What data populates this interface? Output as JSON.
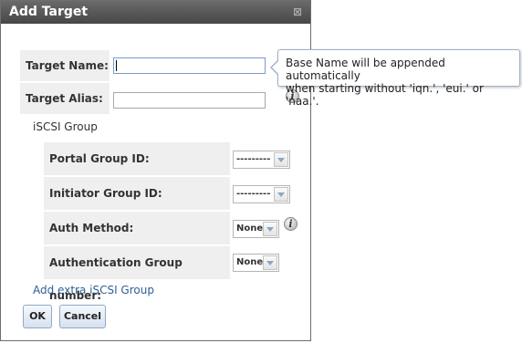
{
  "dialog": {
    "title": "Add Target",
    "close_label": "⊠"
  },
  "fields": {
    "target_name_label": "Target Name:",
    "target_name_value": "",
    "target_alias_label": "Target Alias:",
    "target_alias_value": ""
  },
  "iscsi_group": {
    "heading": "iSCSI Group",
    "portal_group_label": "Portal Group ID:",
    "portal_group_value": "---------",
    "initiator_group_label": "Initiator Group ID:",
    "initiator_group_value": "---------",
    "auth_method_label": "Auth Method:",
    "auth_method_value": "None",
    "auth_group_label": "Authentication Group number:",
    "auth_group_value": "None",
    "add_extra_link": "Add extra iSCSI Group"
  },
  "buttons": {
    "ok": "OK",
    "cancel": "Cancel"
  },
  "tooltip": {
    "line1": "Base Name will be appended automatically",
    "line2": "when starting without 'iqn.', 'eui.' or 'naa.'."
  },
  "icons": {
    "info_glyph": "i"
  },
  "colors": {
    "titlebar": "#474747",
    "label_bg": "#efefef",
    "link": "#2f5f96",
    "button_border": "#8ea9c9"
  }
}
